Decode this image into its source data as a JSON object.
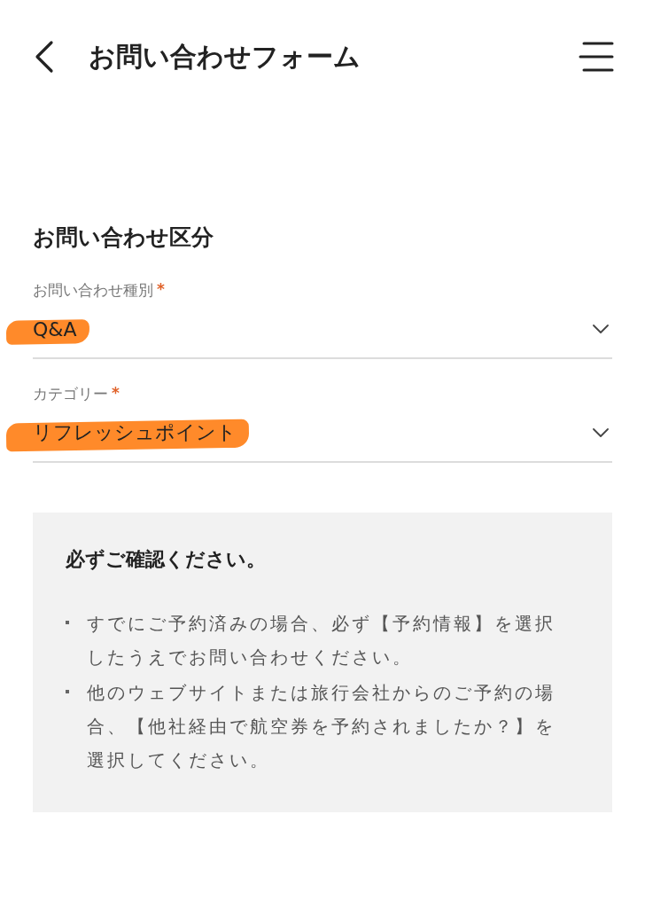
{
  "header": {
    "title": "お問い合わせフォーム"
  },
  "section": {
    "title": "お問い合わせ区分"
  },
  "fields": [
    {
      "label": "お問い合わせ種別",
      "required_mark": "*",
      "value": "Q&A",
      "highlighted": true
    },
    {
      "label": "カテゴリー",
      "required_mark": "*",
      "value": "リフレッシュポイント",
      "highlighted": true
    }
  ],
  "notice": {
    "title": "必ずご確認ください。",
    "items": [
      "すでにご予約済みの場合、必ず【予約情報】を選択したうえでお問い合わせください。",
      "他のウェブサイトまたは旅行会社からのご予約の場合、【他社経由で航空券を予約されましたか？】を選択してください。"
    ]
  }
}
